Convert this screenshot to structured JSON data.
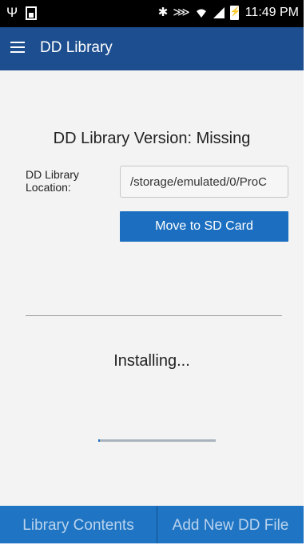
{
  "status_bar": {
    "time": "11:49 PM",
    "icons": [
      "usb-icon",
      "sim-card-icon",
      "bluetooth-icon",
      "vibrate-icon",
      "wifi-icon",
      "signal-icon",
      "battery-charging-icon"
    ]
  },
  "app_bar": {
    "title": "DD Library",
    "menu_icon": "hamburger-menu-icon",
    "color": "#1d4e8f"
  },
  "library": {
    "version_title": "DD Library Version: Missing",
    "location_label": "DD Library Location:",
    "location_value": "/storage/emulated/0/ProC",
    "move_button": "Move to SD Card"
  },
  "install": {
    "status": "Installing...",
    "progress": 0.01
  },
  "bottom_tabs": [
    {
      "label": "Library Contents"
    },
    {
      "label": "Add New DD File"
    }
  ],
  "colors": {
    "accent": "#1c6fc0",
    "bottom_bar": "#1f75c3"
  }
}
